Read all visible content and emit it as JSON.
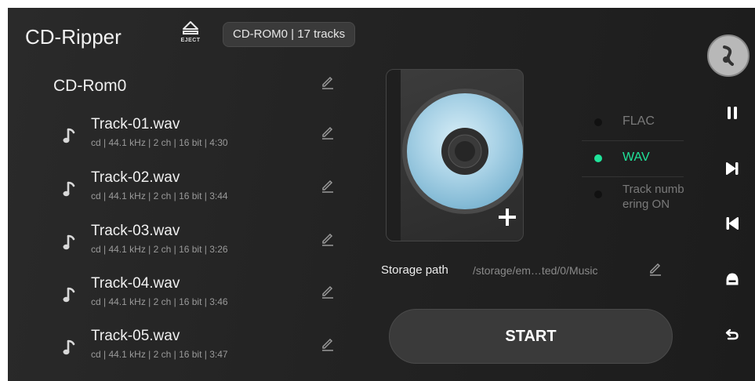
{
  "app": {
    "title": "CD-Ripper"
  },
  "header": {
    "eject_label": "EJECT",
    "drive_info": "CD-ROM0 | 17 tracks"
  },
  "drive": {
    "name": "CD-Rom0"
  },
  "tracks": [
    {
      "name": "Track-01.wav",
      "meta": "cd | 44.1 kHz | 2 ch | 16 bit | 4:30"
    },
    {
      "name": "Track-02.wav",
      "meta": "cd | 44.1 kHz | 2 ch | 16 bit | 3:44"
    },
    {
      "name": "Track-03.wav",
      "meta": "cd | 44.1 kHz | 2 ch | 16 bit | 3:26"
    },
    {
      "name": "Track-04.wav",
      "meta": "cd | 44.1 kHz | 2 ch | 16 bit | 3:46"
    },
    {
      "name": "Track-05.wav",
      "meta": "cd | 44.1 kHz | 2 ch | 16 bit | 3:47"
    }
  ],
  "formats": [
    {
      "label": "FLAC",
      "selected": false
    },
    {
      "label": "WAV",
      "selected": true
    },
    {
      "label": "Track numbering ON",
      "selected": false
    }
  ],
  "storage": {
    "label": "Storage path",
    "path": "/storage/em…ted/0/Music"
  },
  "actions": {
    "start_label": "START"
  },
  "colors": {
    "accent": "#20e39a",
    "background": "#242424",
    "muted_text": "#9a9a9a"
  },
  "icons": {
    "eject": "eject-icon",
    "edit": "pencil-icon",
    "track": "music-note-icon",
    "add": "plus-icon",
    "side": [
      "pause-icon",
      "next-icon",
      "previous-icon",
      "home-icon",
      "back-icon"
    ],
    "avatar": "app-logo-icon"
  }
}
